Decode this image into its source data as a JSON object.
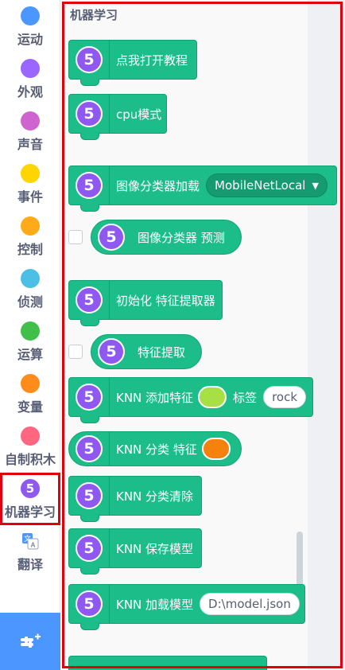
{
  "categories": [
    {
      "label": "运动",
      "color": "#4c97ff"
    },
    {
      "label": "外观",
      "color": "#9966ff"
    },
    {
      "label": "声音",
      "color": "#cf63cf"
    },
    {
      "label": "事件",
      "color": "#ffd500"
    },
    {
      "label": "控制",
      "color": "#ffab19"
    },
    {
      "label": "侦测",
      "color": "#4cbfe6"
    },
    {
      "label": "运算",
      "color": "#40bf4a"
    },
    {
      "label": "变量",
      "color": "#ff8c1a"
    },
    {
      "label": "自制积木",
      "color": "#ff6680"
    },
    {
      "label": "机器学习",
      "icon_text": "5",
      "color": "#8f58f0"
    },
    {
      "label": "翻译",
      "icon": "translate-icon"
    }
  ],
  "extension_button": {
    "icon": "add-extension-icon"
  },
  "flyout": {
    "section_title": "机器学习",
    "blocks": {
      "tutorial": "点我打开教程",
      "cpu_mode": "cpu模式",
      "load_classifier": "图像分类器加载",
      "classifier_model": "MobileNetLocal",
      "classifier_predict": "图像分类器 预测",
      "init_extractor": "初始化 特征提取器",
      "feature_extract": "特征提取",
      "knn_add_feature": "KNN 添加特征",
      "knn_label_word": "标签",
      "knn_label_value": "rock",
      "knn_classify": "KNN 分类 特征",
      "knn_clear": "KNN 分类清除",
      "knn_save": "KNN 保存模型",
      "knn_load": "KNN 加载模型",
      "knn_load_path": "D:\\model.json",
      "icon_text": "5"
    },
    "colors": {
      "add_swatch": "#a6e045",
      "classify_swatch": "#f5820d"
    }
  }
}
